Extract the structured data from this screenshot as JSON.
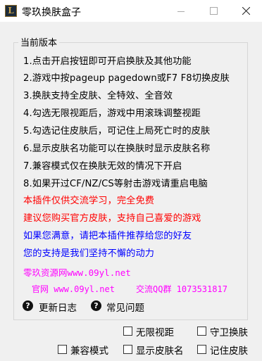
{
  "window": {
    "title": "零玖换肤盒子",
    "app_icon_glyph": "L"
  },
  "version_group": {
    "title": "当前版本",
    "lines": [
      "1.点击开启按钮即可开启换肤及其他功能",
      "2.游戏中按pageup pagedown或F7 F8切换皮肤",
      "3.换肤支持全皮肤、全特效、全音效",
      "4.勾选无限视距后，游戏中用滚珠调整视距",
      "5.勾选记住皮肤后，可记住上局死亡时的皮肤",
      "6.显示皮肤名功能可以在换肤时显示皮肤名称",
      "7.兼容模式仅在换肤无效的情况下开启",
      "8.如果开过CF/NZ/CS等射击游戏请重启电脑"
    ],
    "notice_red_1": "本插件仅供交流学习，完全免费",
    "notice_red_2": "建议您购买官方皮肤，支持自己喜爱的游戏",
    "notice_blue_1": "如果您满意，请把本插件推荐给您的好友",
    "notice_blue_2": "您的支持是我们坚持不懈的动力",
    "resource_link": "零玖资源网www.09yl.net",
    "official_link": "官网 www.09yl.net",
    "qq_group": "交流QQ群 1073531817"
  },
  "links": {
    "changelog": "更新日志",
    "faq": "常见问题"
  },
  "options": {
    "unlimited_view": "无限视距",
    "guard_skin": "守卫换肤",
    "compat_mode": "兼容模式",
    "show_skin_name": "显示皮肤名",
    "remember_skin": "记住皮肤"
  },
  "colors": {
    "red": "#ff0000",
    "blue": "#0000ff",
    "magenta": "#ff00ff"
  }
}
